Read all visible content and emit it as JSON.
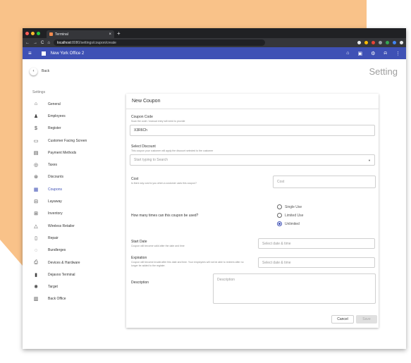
{
  "browser": {
    "tab_title": "Terminal",
    "tab_close": "×",
    "new_tab": "+",
    "url_host": "localhost",
    "url_path": ":8080/settings/coupon/create",
    "nav": [
      "←",
      "→",
      "C",
      "⌂"
    ]
  },
  "appbar": {
    "menu_icon": "≡",
    "store_name": "New York Office 2",
    "right_icons": [
      "⌂",
      "▣",
      "⚙",
      "⍾",
      "⋮"
    ]
  },
  "header": {
    "back_label": "Back",
    "page_title": "Setting"
  },
  "sidebar": {
    "heading": "Settings",
    "items": [
      {
        "icon": "⌂",
        "label": "General"
      },
      {
        "icon": "♟",
        "label": "Employees"
      },
      {
        "icon": "$",
        "label": "Register"
      },
      {
        "icon": "▭",
        "label": "Customer Facing Screen"
      },
      {
        "icon": "▤",
        "label": "Payment Methods"
      },
      {
        "icon": "◎",
        "label": "Taxes"
      },
      {
        "icon": "⊛",
        "label": "Discounts"
      },
      {
        "icon": "▦",
        "label": "Coupons"
      },
      {
        "icon": "⊟",
        "label": "Layaway"
      },
      {
        "icon": "⊞",
        "label": "Inventory"
      },
      {
        "icon": "△",
        "label": "Wireless Retailer"
      },
      {
        "icon": "▯",
        "label": "Repair"
      },
      {
        "icon": "◌",
        "label": "Bundlerges"
      },
      {
        "icon": "⎙",
        "label": "Devices & Hardware"
      },
      {
        "icon": "▮",
        "label": "Dejavoo Terminal"
      },
      {
        "icon": "✺",
        "label": "Target"
      },
      {
        "icon": "▥",
        "label": "Back Office"
      }
    ],
    "active_index": 7
  },
  "form": {
    "title": "New Coupon",
    "coupon_code_label": "Coupon Code",
    "coupon_code_hint": "Scan the code / manual entry will need to provide",
    "coupon_code_value": "X3R6Ch",
    "discount_label": "Select Discount",
    "discount_hint": "This coupon your customer will apply the discount selected to the customer",
    "discount_placeholder": "Start typing to Search",
    "cost_label": "Cost",
    "cost_hint": "Is there any cost to you when a customer uses this coupon?",
    "cost_placeholder": "Cost",
    "uses_label": "How many times can this coupon be used?",
    "uses_options": [
      "Single Use",
      "Limited Use",
      "Unlimited"
    ],
    "uses_selected": 2,
    "start_label": "Start Date",
    "start_hint": "Coupon will become valid after the date and time",
    "start_placeholder": "Select date & time",
    "expiry_label": "Expiration",
    "expiry_hint": "Coupon will become invalid after this date and time. Your employees will not be able to redeem after no longer be added to the register.",
    "expiry_placeholder": "Select date & time",
    "desc_label": "Description",
    "desc_placeholder": "Description",
    "cancel_label": "Cancel",
    "save_label": "Save"
  },
  "colors": {
    "primary": "#3f51b5",
    "accent_bg": "#f9c289"
  }
}
